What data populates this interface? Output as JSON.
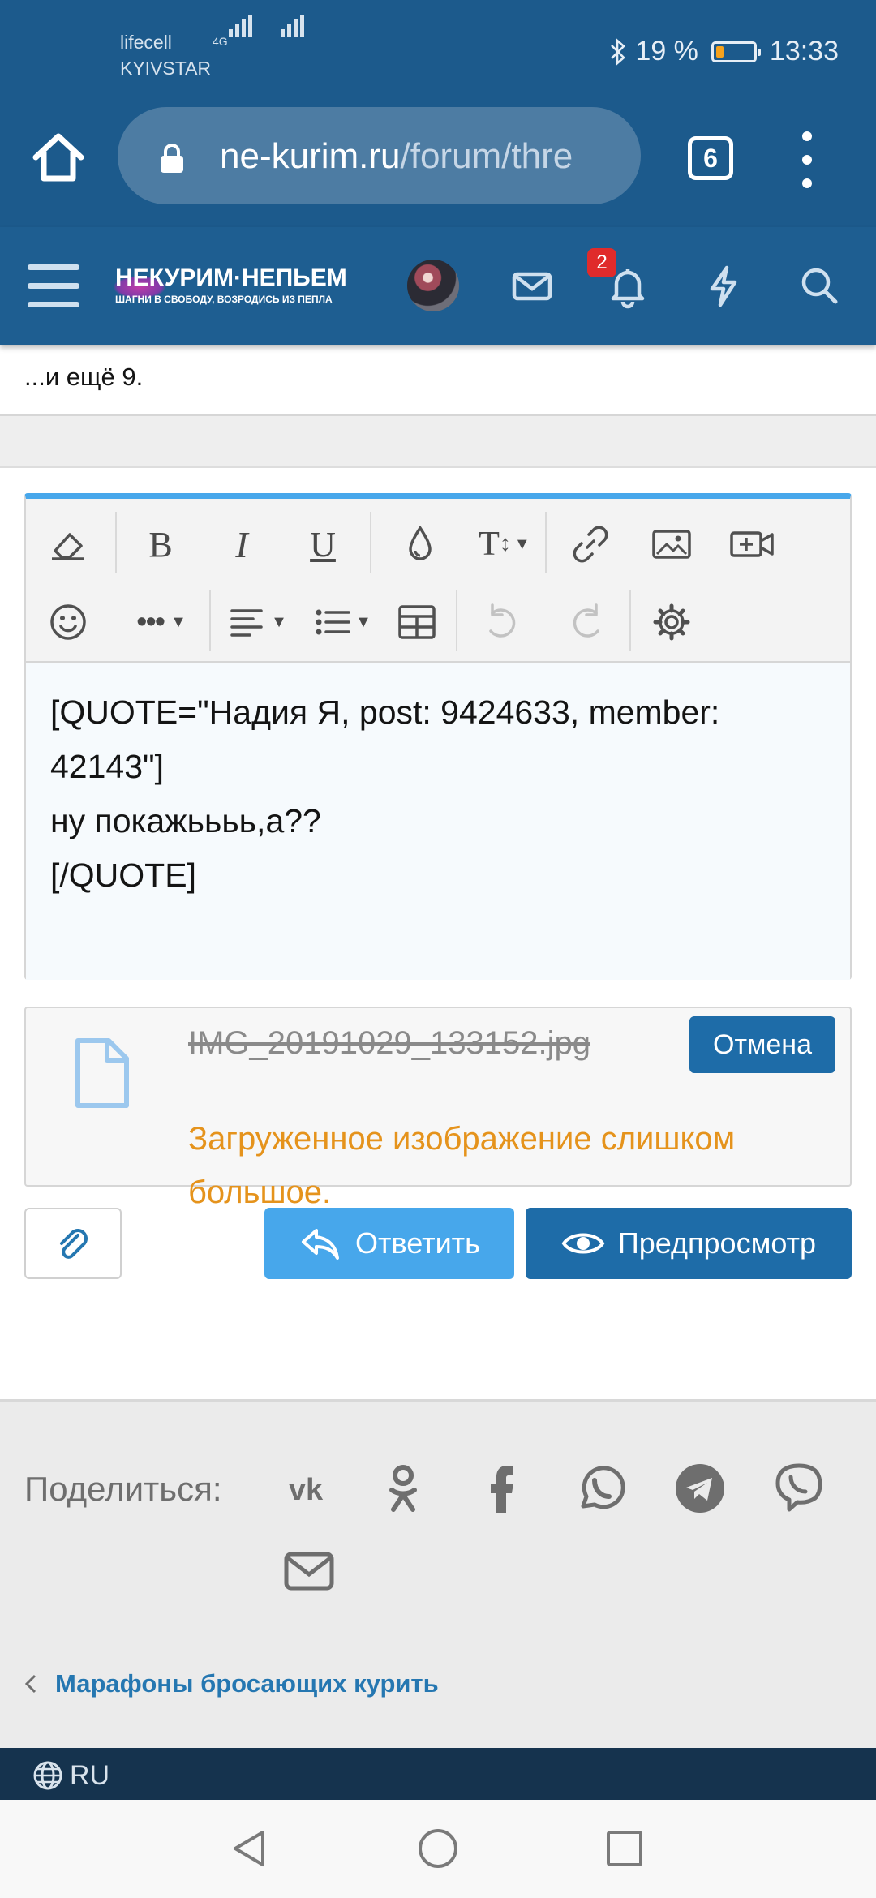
{
  "status_bar": {
    "carrier_1": "lifecell",
    "carrier_2": "KYIVSTAR",
    "network_type": "4G",
    "bluetooth_icon": "bluetooth-icon",
    "battery_percent": "19 %",
    "battery_level": 0.19,
    "time": "13:33"
  },
  "browser": {
    "url_domain": "ne-kurim.ru",
    "url_path": "/forum/thre",
    "tab_count": "6"
  },
  "site_header": {
    "logo_main": "НЕКУРИМ·НЕПЬЕМ",
    "logo_sub": "ШАГНИ В СВОБОДУ, ВОЗРОДИСЬ ИЗ ПЕПЛА",
    "notification_count": "2"
  },
  "thread": {
    "more_members": "...и ещё 9."
  },
  "editor": {
    "content": "[QUOTE=\"Надия Я, post: 9424633, member: 42143\"]\nну покажьььь,а??\n[/QUOTE]",
    "toolbar": [
      "eraser-icon",
      "bold-icon",
      "italic-icon",
      "underline-icon",
      "color-drop-icon",
      "text-size-icon",
      "link-icon",
      "image-icon",
      "video-icon",
      "emoji-icon",
      "more-icon",
      "align-icon",
      "list-icon",
      "table-icon",
      "undo-icon",
      "redo-icon",
      "settings-icon"
    ]
  },
  "attachment": {
    "file_name": "IMG_20191029_133152.jpg",
    "cancel_label": "Отмена",
    "error": "Загруженное изображение слишком большое."
  },
  "actions": {
    "reply_label": "Ответить",
    "preview_label": "Предпросмотр"
  },
  "share": {
    "label": "Поделиться:",
    "networks": [
      "vk-icon",
      "odnoklassniki-icon",
      "facebook-icon",
      "whatsapp-icon",
      "telegram-icon",
      "viber-icon",
      "email-icon"
    ]
  },
  "breadcrumb": {
    "label": "Марафоны бросающих курить"
  },
  "footer": {
    "language": "RU"
  },
  "colors": {
    "header_blue": "#1c5a8c",
    "accent_blue": "#47a7eb",
    "button_blue": "#1e6ca8",
    "error_orange": "#e5931c",
    "badge_red": "#e02b2b"
  }
}
